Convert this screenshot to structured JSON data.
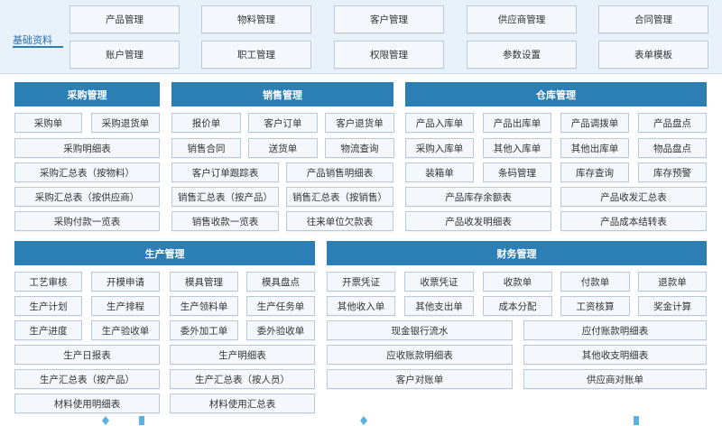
{
  "basic": {
    "title": "基础资料",
    "row1": [
      "产品管理",
      "物料管理",
      "客户管理",
      "供应商管理",
      "合同管理"
    ],
    "row2": [
      "账户管理",
      "职工管理",
      "权限管理",
      "参数设置",
      "表单模板"
    ]
  },
  "purchase": {
    "title": "采购管理",
    "items": [
      "采购单",
      "采购退货单",
      "采购明细表",
      "采购汇总表（按物料）",
      "采购汇总表（按供应商）",
      "采购付款一览表"
    ]
  },
  "sales": {
    "title": "销售管理",
    "items": [
      "报价单",
      "客户订单",
      "客户退货单",
      "销售合同",
      "送货单",
      "物流查询",
      "客户订单跟踪表",
      "产品销售明细表",
      "销售汇总表（按产品）",
      "销售汇总表（按销售）",
      "销售收款一览表",
      "往来单位欠款表"
    ]
  },
  "warehouse": {
    "title": "仓库管理",
    "items": [
      "产品入库单",
      "产品出库单",
      "产品调拨单",
      "产品盘点",
      "采购入库单",
      "其他入库单",
      "其他出库单",
      "物品盘点",
      "装箱单",
      "条码管理",
      "库存查询",
      "库存预警",
      "产品库存余额表",
      "产品收发汇总表",
      "产品收发明细表",
      "产品成本结转表"
    ]
  },
  "production": {
    "title": "生产管理",
    "items": [
      "工艺审核",
      "开模申请",
      "模具管理",
      "模具盘点",
      "生产计划",
      "生产排程",
      "生产领料单",
      "生产任务单",
      "生产进度",
      "生产验收单",
      "委外加工单",
      "委外验收单",
      "生产日报表",
      "生产明细表",
      "生产汇总表（按产品）",
      "生产汇总表（按人员）",
      "材料使用明细表",
      "材料使用汇总表"
    ]
  },
  "finance": {
    "title": "财务管理",
    "items": [
      "开票凭证",
      "收票凭证",
      "收款单",
      "付款单",
      "退款单",
      "其他收入单",
      "其他支出单",
      "成本分配",
      "工资核算",
      "奖金计算",
      "现金银行流水",
      "应付账款明细表",
      "应收账款明细表",
      "其他收支明细表",
      "客户对账单",
      "供应商对账单"
    ]
  },
  "colors": {
    "header": "#2b7fb5",
    "button_bg": "#f4f8fc",
    "button_border": "#b8c9dc",
    "panel_bg": "#e8f1f9"
  }
}
